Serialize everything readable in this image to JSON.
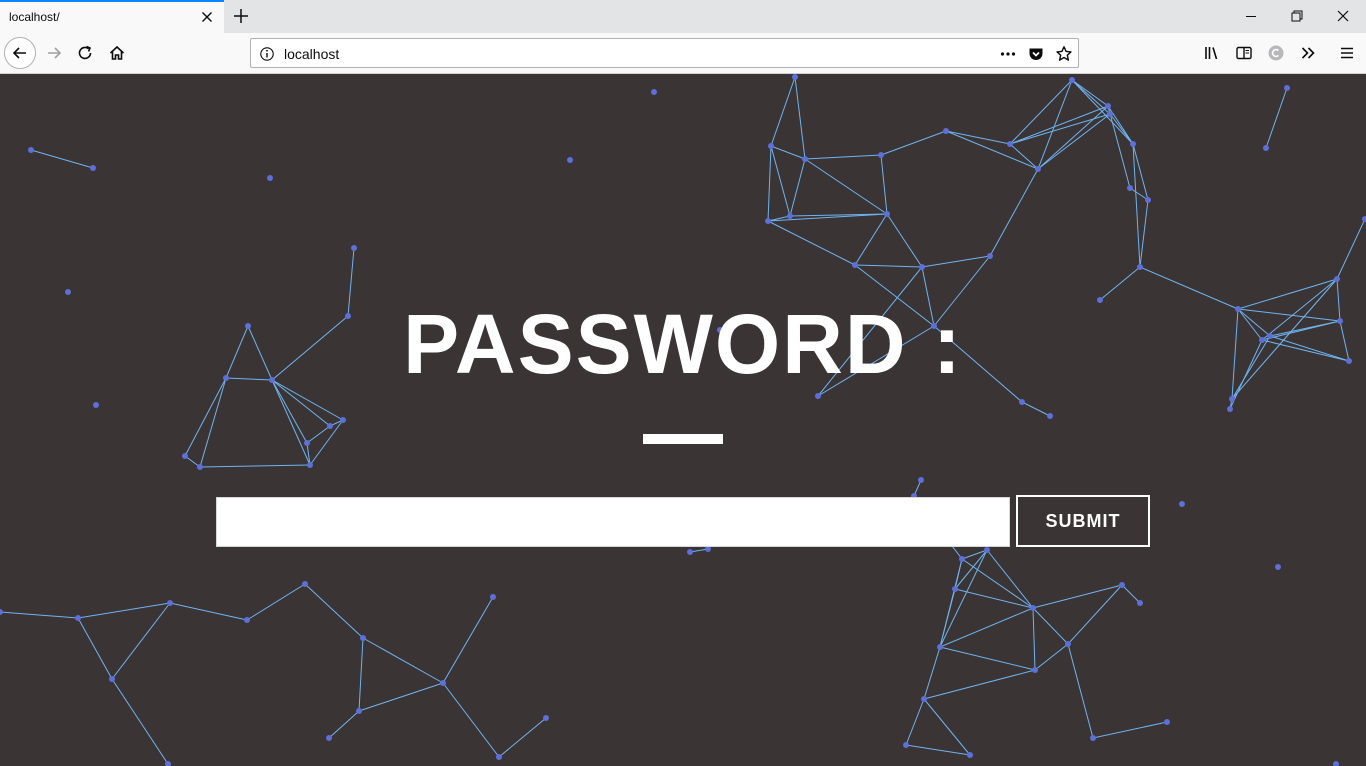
{
  "browser": {
    "tab_title": "localhost/",
    "url": "localhost",
    "accent_color": "#0a84ff"
  },
  "icons": {
    "tab_close": "close-icon",
    "new_tab": "plus-icon",
    "minimize": "minimize-icon",
    "restore": "restore-icon",
    "close_window": "close-icon",
    "back": "arrow-left-icon",
    "forward": "arrow-right-icon",
    "reload": "reload-icon",
    "home": "home-icon",
    "site_info": "info-icon",
    "page_actions": "more-dots-icon",
    "pocket": "pocket-icon",
    "bookmark": "star-icon",
    "library": "library-icon",
    "sidebar": "sidebar-icon",
    "extension": "extension-icon",
    "overflow": "chevron-double-right-icon",
    "menu": "hamburger-menu-icon"
  },
  "page": {
    "heading": "PASSWORD :",
    "password_value": "",
    "submit_label": "SUBMIT",
    "background_color": "#3a3435",
    "particle_color": "#5d6fd8",
    "line_color": "#6fb4f0"
  }
}
